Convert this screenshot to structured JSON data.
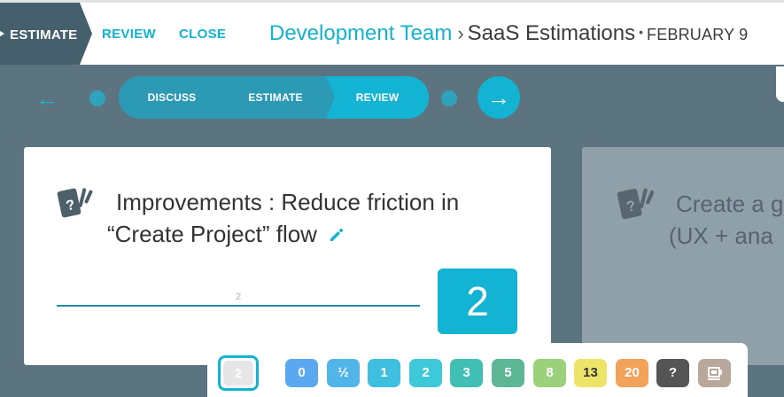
{
  "topbar": {
    "estimate_label": "ESTIMATE",
    "review_label": "REVIEW",
    "close_label": "CLOSE",
    "breadcrumb": {
      "team": "Development Team",
      "separator": "›",
      "project": "SaaS Estimations",
      "dot": "•",
      "date": "FEBRUARY 9"
    }
  },
  "stages": {
    "back_icon": "←",
    "next_icon": "→",
    "items": [
      "DISCUSS",
      "ESTIMATE",
      "REVIEW"
    ],
    "active": "REVIEW"
  },
  "card": {
    "title_line1": "Improvements : Reduce friction in",
    "title_line2": "“Create Project” flow",
    "estimate_input_value": "2",
    "estimate_value": "2"
  },
  "next_card": {
    "title_line1": "Create a g",
    "title_line2": "(UX + ana"
  },
  "palette": {
    "selected_value": "2",
    "chips": [
      {
        "label": "0",
        "color": "#5aa9f0"
      },
      {
        "label": "½",
        "color": "#52b5ea"
      },
      {
        "label": "1",
        "color": "#3ebfe0"
      },
      {
        "label": "2",
        "color": "#3dc9d8"
      },
      {
        "label": "3",
        "color": "#42bfb5"
      },
      {
        "label": "5",
        "color": "#5db796"
      },
      {
        "label": "8",
        "color": "#9bd17b"
      },
      {
        "label": "13",
        "color": "#ece56a",
        "text_color": "#333333"
      },
      {
        "label": "20",
        "color": "#f3a25a"
      },
      {
        "label": "?",
        "color": "#555555"
      },
      {
        "label": "coffee-icon",
        "color": "#b8a79b",
        "icon": true
      }
    ]
  },
  "colors": {
    "accent": "#13b3d4",
    "background": "#5b7480",
    "estimate_tab": "#45606c"
  }
}
